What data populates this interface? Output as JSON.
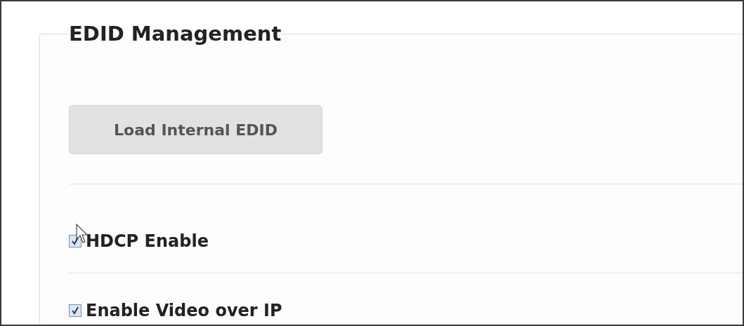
{
  "section": {
    "title": "EDID Management"
  },
  "button": {
    "label": "Load Internal EDID"
  },
  "options": [
    {
      "label": "HDCP Enable",
      "checked": true,
      "hovered": true
    },
    {
      "label": "Enable Video over IP",
      "checked": true,
      "hovered": false
    }
  ]
}
